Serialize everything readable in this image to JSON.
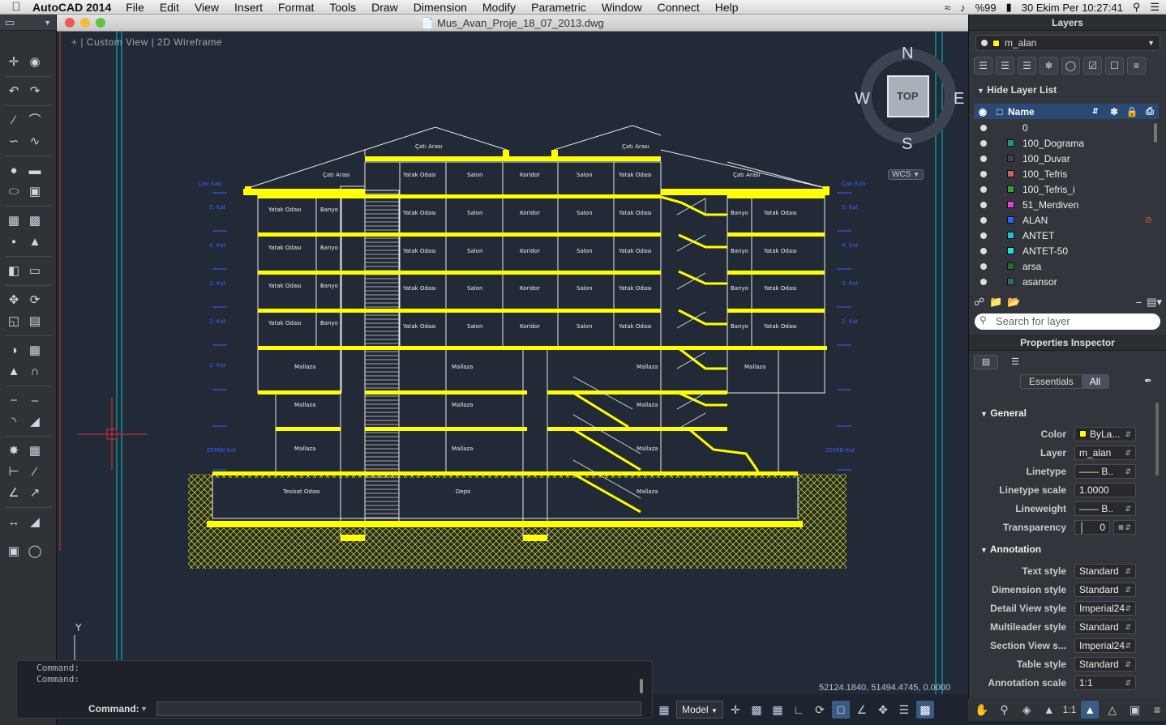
{
  "menubar": {
    "app_name": "AutoCAD 2014",
    "items": [
      "File",
      "Edit",
      "View",
      "Insert",
      "Format",
      "Tools",
      "Draw",
      "Dimension",
      "Modify",
      "Parametric",
      "Window",
      "Connect",
      "Help"
    ],
    "battery": "%99",
    "clock": "30 Ekim Per  10:27:41"
  },
  "window": {
    "title": "Mus_Avan_Proje_18_07_2013.dwg"
  },
  "viewport": {
    "label": "+ | Custom View | 2D Wireframe",
    "viewcube": {
      "n": "N",
      "s": "S",
      "e": "E",
      "w": "W",
      "face": "TOP"
    },
    "wcs": "WCS",
    "coordinates": "52124.1840, 51494.4745, 0.0000"
  },
  "drawing": {
    "roof_labels": [
      "Çatı Arası",
      "Çatı Arası",
      "Çatı Arası",
      "Çatı Arası"
    ],
    "room_labels": {
      "yatak": "Yatak Odası",
      "banyo": "Banyo",
      "salon": "Salon",
      "koridor": "Koridor",
      "mallaza": "Mallaza",
      "tesisat": "Tesisat Odası",
      "depo": "Depo"
    },
    "floor_labels": [
      "Çatı Katı",
      "5. Kat",
      "4. Kat",
      "3. Kat",
      "2. Kat",
      "1. Kat",
      "ZEMİN Kat"
    ],
    "ucs_label": "Y"
  },
  "command": {
    "history": [
      "Command:",
      "Command:"
    ],
    "label": "Command:",
    "input_value": ""
  },
  "status": {
    "model_label": "Model",
    "scale": "1:1"
  },
  "layers": {
    "title": "Layers",
    "current": "m_alan",
    "hide_list_label": "Hide Layer List",
    "name_header": "Name",
    "rows": [
      {
        "name": "0",
        "color": "#ffffff"
      },
      {
        "name": "100_Dograma",
        "color": "#1a9a8a"
      },
      {
        "name": "100_Duvar",
        "color": "#444444"
      },
      {
        "name": "100_Tefris",
        "color": "#c86464"
      },
      {
        "name": "100_Tefris_i",
        "color": "#3aa03a"
      },
      {
        "name": "51_Merdiven",
        "color": "#e040e0"
      },
      {
        "name": "ALAN",
        "color": "#3060ff"
      },
      {
        "name": "ANTET",
        "color": "#20c0e0"
      },
      {
        "name": "ANTET-50",
        "color": "#20e0e0"
      },
      {
        "name": "arsa",
        "color": "#2a6a2a"
      },
      {
        "name": "asansor",
        "color": "#3a6a7a"
      }
    ],
    "search_placeholder": "Search for layer"
  },
  "properties": {
    "title": "Properties Inspector",
    "tab_essentials": "Essentials",
    "tab_all": "All",
    "general_title": "General",
    "general": [
      {
        "label": "Color",
        "value": "ByLa..."
      },
      {
        "label": "Layer",
        "value": "m_alan"
      },
      {
        "label": "Linetype",
        "value": "B.."
      },
      {
        "label": "Linetype scale",
        "value": "1.0000"
      },
      {
        "label": "Lineweight",
        "value": "B.."
      },
      {
        "label": "Transparency",
        "value": "0"
      }
    ],
    "annotation_title": "Annotation",
    "annotation": [
      {
        "label": "Text style",
        "value": "Standard"
      },
      {
        "label": "Dimension style",
        "value": "Standard"
      },
      {
        "label": "Detail View style",
        "value": "Imperial24"
      },
      {
        "label": "Multileader style",
        "value": "Standard"
      },
      {
        "label": "Section View s...",
        "value": "Imperial24"
      },
      {
        "label": "Table style",
        "value": "Standard"
      },
      {
        "label": "Annotation scale",
        "value": "1:1"
      }
    ]
  },
  "colors": {
    "accent_yellow": "#ffff00",
    "background": "#222a37",
    "cyan_line": "#00c8d0"
  }
}
